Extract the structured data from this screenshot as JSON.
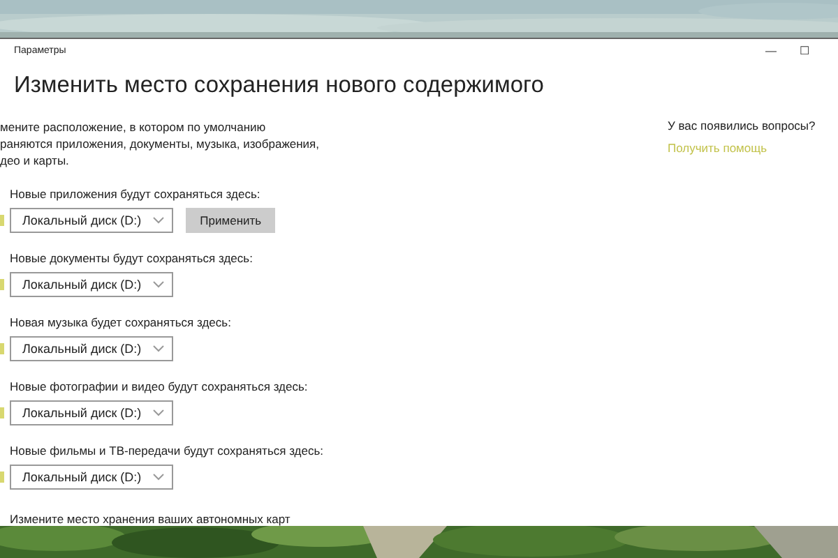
{
  "window": {
    "title": "Параметры",
    "controls": [
      "—",
      "☐"
    ]
  },
  "heading": "Изменить место сохранения нового содержимого",
  "description_lines": [
    "мените расположение, в котором по умолчанию",
    "раняются приложения, документы, музыка, изображения,",
    "део и карты."
  ],
  "sections": [
    {
      "label": "Новые приложения будут сохраняться здесь:",
      "value": "Локальный диск (D:)",
      "apply_button": "Применить"
    },
    {
      "label": "Новые документы будут сохраняться здесь:",
      "value": "Локальный диск (D:)"
    },
    {
      "label": "Новая музыка будет сохраняться здесь:",
      "value": "Локальный диск (D:)"
    },
    {
      "label": "Новые фотографии и видео будут сохраняться здесь:",
      "value": "Локальный диск (D:)"
    },
    {
      "label": "Новые фильмы и ТВ-передачи будут сохраняться здесь:",
      "value": "Локальный диск (D:)"
    }
  ],
  "footer_text": "Измените место хранения ваших автономных карт",
  "help": {
    "question": "У вас появились вопросы?",
    "link": "Получить помощь"
  }
}
